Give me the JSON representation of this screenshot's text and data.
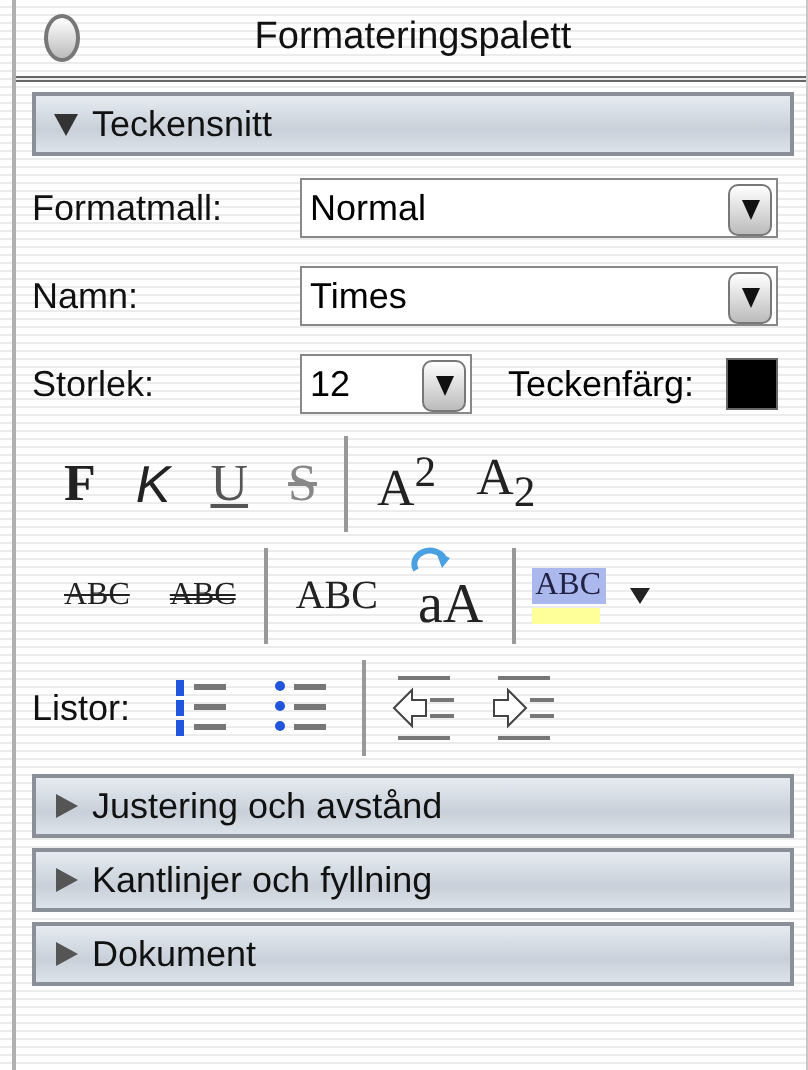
{
  "window": {
    "title": "Formateringspalett"
  },
  "sections": [
    {
      "title": "Teckensnitt",
      "expanded": true,
      "fields": [
        {
          "kind": "select",
          "label": "Formatmall:",
          "value": "Normal"
        },
        {
          "kind": "select",
          "label": "Namn:",
          "value": "Times"
        }
      ],
      "size": {
        "label": "Storlek:",
        "value": "12"
      },
      "font_color": {
        "label": "Teckenfärg:",
        "color": "#000000"
      },
      "style_rows": [
        [
          [
            {
              "kind": "bold",
              "label": "F"
            },
            {
              "kind": "italic",
              "label": "K"
            },
            {
              "kind": "underline",
              "label": "U"
            },
            {
              "kind": "shadow",
              "label": "S"
            }
          ],
          [
            {
              "kind": "plain",
              "label": "A$^{2}$"
            },
            {
              "kind": "plain",
              "label": "A$_{2}$"
            }
          ]
        ],
        [
          [
            {
              "kind": "strike",
              "label": "ABC"
            },
            {
              "kind": "double-strike",
              "label": "ABC"
            }
          ],
          [
            {
              "kind": "smallcaps",
              "label": "ABC"
            },
            {
              "kind": "change-case",
              "label": "aA"
            }
          ],
          [
            {
              "kind": "highlight",
              "label": "ABC",
              "color": "#ffff99"
            }
          ]
        ]
      ],
      "lists": {
        "label": "Listor:",
        "groups": [
          [
            {
              "kind": "numbered"
            },
            {
              "kind": "bulleted"
            }
          ],
          [
            {
              "kind": "outdent"
            },
            {
              "kind": "indent"
            }
          ]
        ]
      }
    },
    {
      "title": "Justering och avstånd",
      "expanded": false
    },
    {
      "title": "Kantlinjer och fyllning",
      "expanded": false
    },
    {
      "title": "Dokument",
      "expanded": false
    }
  ]
}
